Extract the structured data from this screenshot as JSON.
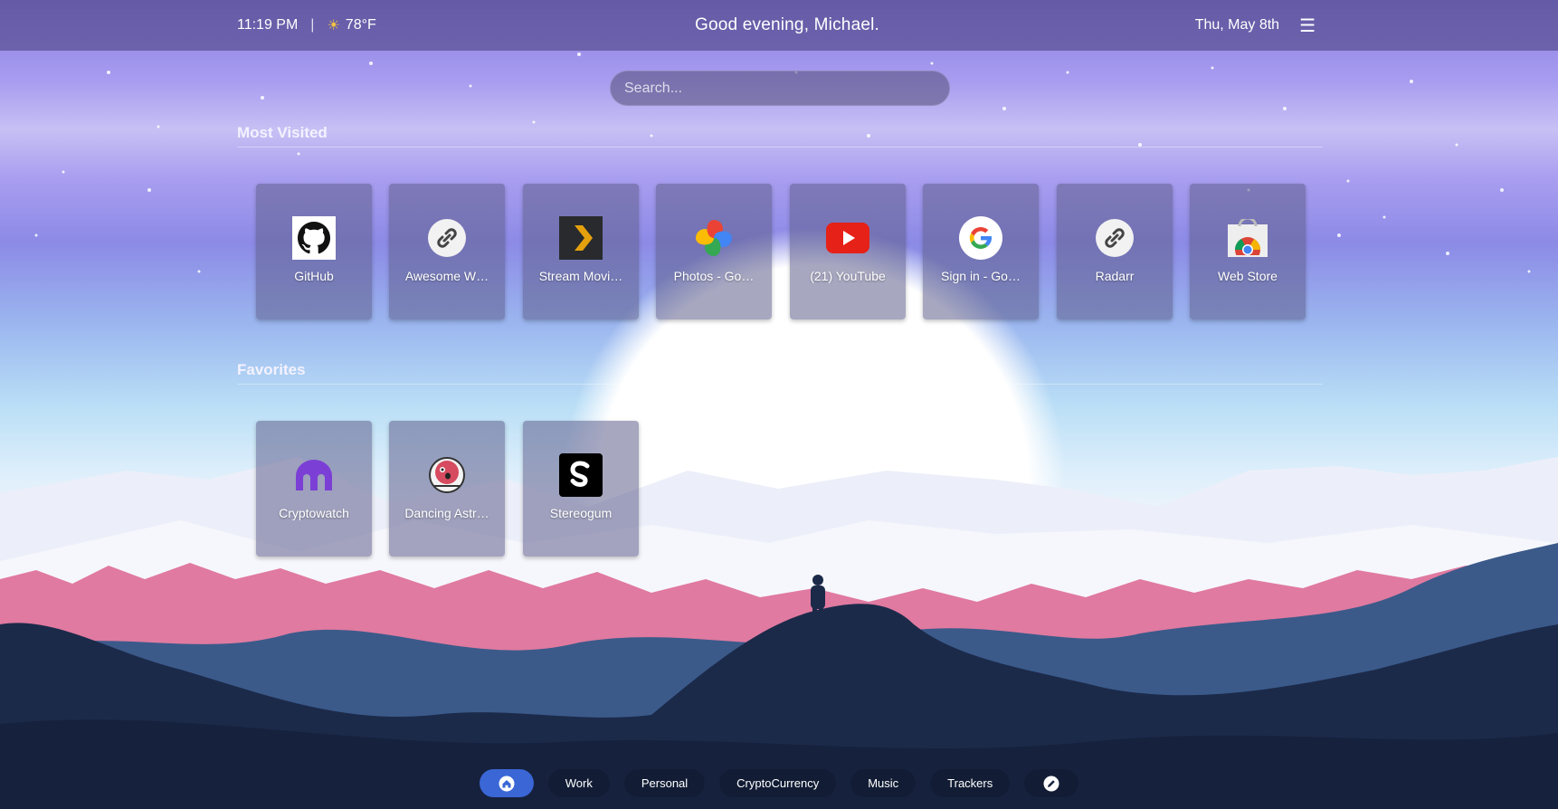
{
  "topbar": {
    "time": "11:19 PM",
    "separator": "|",
    "weather_icon": "sun-icon",
    "temperature": "78°F",
    "greeting": "Good evening, Michael.",
    "date": "Thu, May 8th",
    "menu_icon": "☰"
  },
  "search": {
    "placeholder": "Search..."
  },
  "sections": {
    "most_visited": {
      "title": "Most Visited",
      "tiles": [
        {
          "label": "GitHub",
          "icon": "github-icon"
        },
        {
          "label": "Awesome W…",
          "icon": "link-icon"
        },
        {
          "label": "Stream Movi…",
          "icon": "plex-icon"
        },
        {
          "label": "Photos - Go…",
          "icon": "google-photos-icon"
        },
        {
          "label": "(21) YouTube",
          "icon": "youtube-icon"
        },
        {
          "label": "Sign in - Go…",
          "icon": "google-icon"
        },
        {
          "label": "Radarr",
          "icon": "link-icon"
        },
        {
          "label": "Web Store",
          "icon": "chrome-web-store-icon"
        }
      ]
    },
    "favorites": {
      "title": "Favorites",
      "tiles": [
        {
          "label": "Cryptowatch",
          "icon": "cryptowatch-icon"
        },
        {
          "label": "Dancing Astr…",
          "icon": "dancing-astronaut-icon"
        },
        {
          "label": "Stereogum",
          "icon": "stereogum-icon"
        }
      ]
    }
  },
  "bottom_nav": {
    "home_icon": "home-icon",
    "items": [
      "Work",
      "Personal",
      "CryptoCurrency",
      "Music",
      "Trackers"
    ],
    "edit_icon": "edit-icon"
  },
  "colors": {
    "accent": "#3a66d6",
    "pill": "#121c34",
    "pink": "#e07aa0",
    "mountain_dark": "#1c2a4a"
  }
}
